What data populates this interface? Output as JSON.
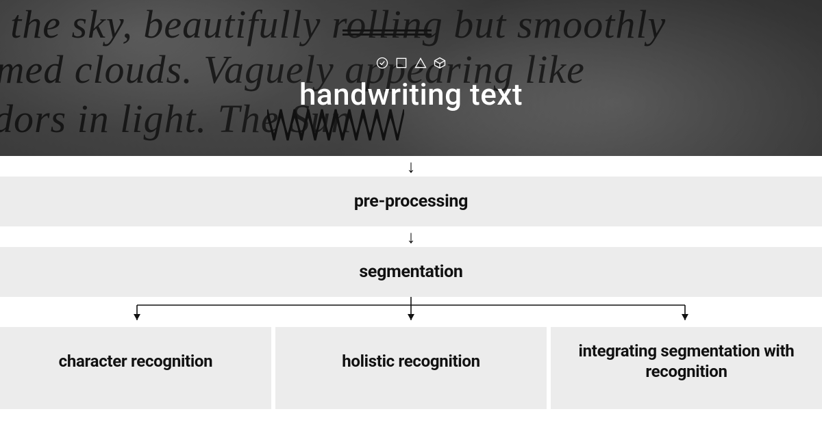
{
  "hero": {
    "title": "handwriting text",
    "script_line1": "w the sky, beautifully rolling but smoothly",
    "script_line2": "ormed clouds.  Vaguely appearing like",
    "script_line3": "ondors   in                       light.   The Sun"
  },
  "stages": {
    "preprocessing": "pre-processing",
    "segmentation": "segmentation"
  },
  "leaves": {
    "character": "character recognition",
    "holistic": "holistic recognition",
    "integrating": "integrating segmentation with recognition"
  },
  "chart_data": {
    "type": "flowchart",
    "title": "handwriting text",
    "nodes": [
      {
        "id": "root",
        "label": "handwriting text"
      },
      {
        "id": "pre",
        "label": "pre-processing"
      },
      {
        "id": "seg",
        "label": "segmentation"
      },
      {
        "id": "char",
        "label": "character recognition"
      },
      {
        "id": "hol",
        "label": "holistic recognition"
      },
      {
        "id": "int",
        "label": "integrating segmentation with recognition"
      }
    ],
    "edges": [
      {
        "from": "root",
        "to": "pre"
      },
      {
        "from": "pre",
        "to": "seg"
      },
      {
        "from": "seg",
        "to": "char"
      },
      {
        "from": "seg",
        "to": "hol"
      },
      {
        "from": "seg",
        "to": "int"
      }
    ]
  }
}
